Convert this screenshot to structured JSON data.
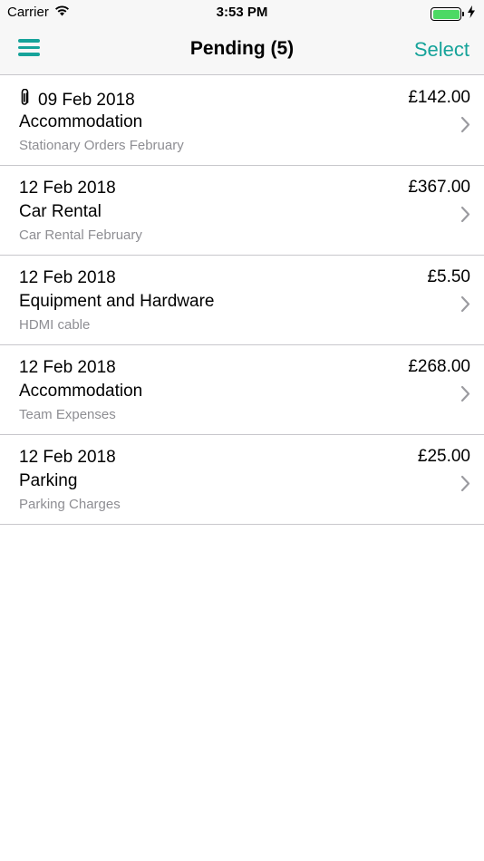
{
  "status_bar": {
    "carrier": "Carrier",
    "time": "3:53 PM",
    "battery_color": "#4cd964"
  },
  "nav": {
    "title": "Pending (5)",
    "select_label": "Select",
    "menu_icon": "hamburger-menu-icon",
    "accent_color": "#16a39a"
  },
  "expenses": [
    {
      "date": "09 Feb 2018",
      "category": "Accommodation",
      "description": "Stationary Orders February",
      "amount": "£142.00",
      "has_attachment": true
    },
    {
      "date": "12 Feb 2018",
      "category": "Car Rental",
      "description": "Car Rental February",
      "amount": "£367.00",
      "has_attachment": false
    },
    {
      "date": "12 Feb 2018",
      "category": "Equipment and Hardware",
      "description": "HDMI cable",
      "amount": "£5.50",
      "has_attachment": false
    },
    {
      "date": "12 Feb 2018",
      "category": "Accommodation",
      "description": "Team Expenses",
      "amount": "£268.00",
      "has_attachment": false
    },
    {
      "date": "12 Feb 2018",
      "category": "Parking",
      "description": "Parking Charges",
      "amount": "£25.00",
      "has_attachment": false
    }
  ]
}
